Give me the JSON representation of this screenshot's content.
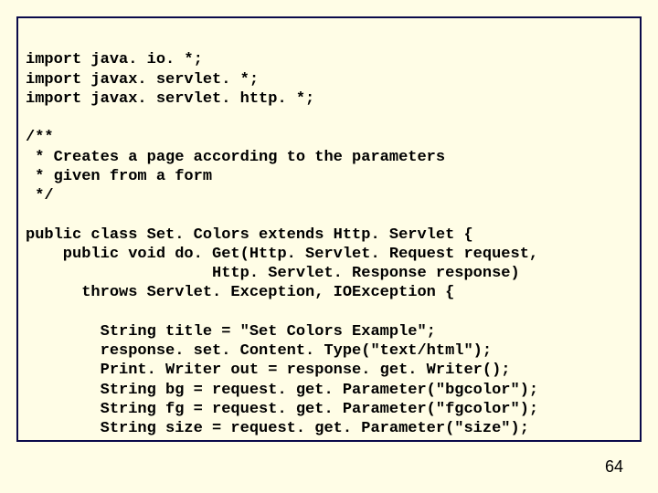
{
  "code": {
    "l01": "import java. io. *;",
    "l02": "import javax. servlet. *;",
    "l03": "import javax. servlet. http. *;",
    "l04": "",
    "l05": "/**",
    "l06": " * Creates a page according to the parameters",
    "l07": " * given from a form",
    "l08": " */",
    "l09": "",
    "l10": "public class Set. Colors extends Http. Servlet {",
    "l11": "    public void do. Get(Http. Servlet. Request request,",
    "l12": "                    Http. Servlet. Response response)",
    "l13": "      throws Servlet. Exception, IOException {",
    "l14": "",
    "l15": "        String title = \"Set Colors Example\";",
    "l16": "        response. set. Content. Type(\"text/html\");",
    "l17": "        Print. Writer out = response. get. Writer();",
    "l18": "        String bg = request. get. Parameter(\"bgcolor\");",
    "l19": "        String fg = request. get. Parameter(\"fgcolor\");",
    "l20": "        String size = request. get. Parameter(\"size\");"
  },
  "page_number": "64"
}
